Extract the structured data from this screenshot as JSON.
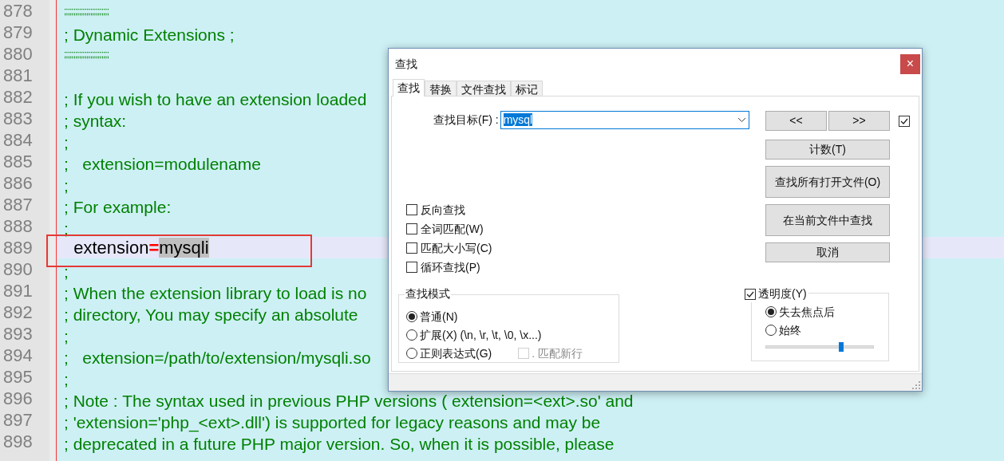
{
  "editor": {
    "lines": [
      {
        "number": "878",
        "text": ";;;;;;;;;;;;;;;;;;;;;;;;",
        "kind": "rule"
      },
      {
        "number": "879",
        "text": "; Dynamic Extensions ;"
      },
      {
        "number": "880",
        "text": ";;;;;;;;;;;;;;;;;;;;;;;;",
        "kind": "rule"
      },
      {
        "number": "881"
      },
      {
        "number": "882",
        "text": "; If you wish to have an extension loaded"
      },
      {
        "number": "883",
        "text": "; syntax:"
      },
      {
        "number": "884",
        "text": ";"
      },
      {
        "number": "885",
        "text": ";   extension=modulename"
      },
      {
        "number": "886",
        "text": ";"
      },
      {
        "number": "887",
        "text": "; For example:"
      },
      {
        "number": "888",
        "text": ";"
      },
      {
        "number": "889",
        "current": true,
        "annotated": true,
        "segments": [
          {
            "text": "  extension",
            "kind": "plain"
          },
          {
            "text": "=",
            "kind": "operator"
          },
          {
            "text": "mysqli",
            "kind": "match"
          }
        ]
      },
      {
        "number": "890",
        "text": ";"
      },
      {
        "number": "891",
        "text": "; When the extension library to load is no"
      },
      {
        "number": "892",
        "text": "; directory, You may specify an absolute"
      },
      {
        "number": "893",
        "text": ";"
      },
      {
        "number": "894",
        "text": ";   extension=/path/to/extension/mysqli.so"
      },
      {
        "number": "895",
        "text": ";"
      },
      {
        "number": "896",
        "text": "; Note : The syntax used in previous PHP versions ( extension=<ext>.so' and"
      },
      {
        "number": "897",
        "text": "; 'extension='php_<ext>.dll') is supported for legacy reasons and may be"
      },
      {
        "number": "898",
        "text": "; deprecated in a future PHP major version. So, when it is possible, please"
      }
    ]
  },
  "dialog": {
    "title": "查找",
    "close": "×",
    "tabs": [
      {
        "label": "查找",
        "selected": true
      },
      {
        "label": "替换",
        "selected": false
      },
      {
        "label": "文件查找",
        "selected": false
      },
      {
        "label": "标记",
        "selected": false
      }
    ],
    "find_label": "查找目标(F) :",
    "find_value": "mysql",
    "prev_button": "<<",
    "next_button": ">>",
    "wrap_checked": true,
    "buttons": [
      "计数(T)",
      "查找所有打开文件(O)",
      "在当前文件中查找",
      "取消"
    ],
    "options": [
      {
        "label": "反向查找",
        "checked": false
      },
      {
        "label": "全词匹配(W)",
        "checked": false
      },
      {
        "label": "匹配大小写(C)",
        "checked": false
      },
      {
        "label": "循环查找(P)",
        "checked": false
      }
    ],
    "search_mode": {
      "title": "查找模式",
      "options": [
        {
          "label": "普通(N)",
          "selected": true
        },
        {
          "label": "扩展(X) (\\n, \\r, \\t, \\0, \\x...)",
          "selected": false
        },
        {
          "label": "正则表达式(G)",
          "selected": false
        }
      ],
      "newline": {
        "label": ". 匹配新行",
        "checked": false,
        "disabled": true
      }
    },
    "transparency": {
      "label": "透明度(Y)",
      "checked": true,
      "options": [
        {
          "label": "失去焦点后",
          "selected": true
        },
        {
          "label": "始终",
          "selected": false
        }
      ],
      "level": 0.7
    }
  }
}
